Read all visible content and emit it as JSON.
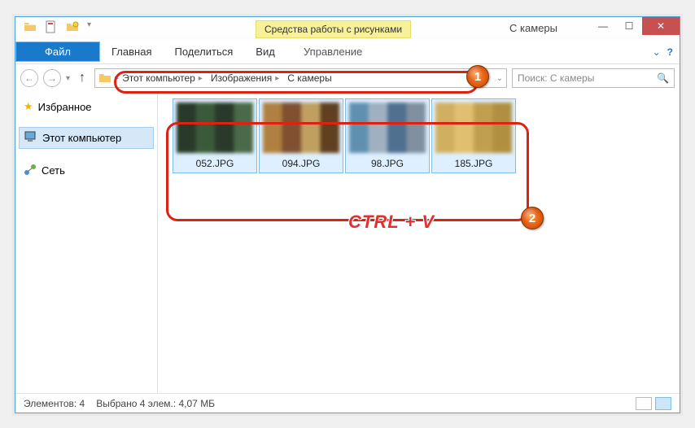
{
  "titlebar": {
    "tools_tab": "Средства работы с рисунками",
    "window_title": "С камеры"
  },
  "ribbon": {
    "file": "Файл",
    "home": "Главная",
    "share": "Поделиться",
    "view": "Вид",
    "manage": "Управление"
  },
  "breadcrumbs": {
    "items": [
      {
        "label": "Этот компьютер"
      },
      {
        "label": "Изображения"
      },
      {
        "label": "С камеры"
      }
    ]
  },
  "search": {
    "placeholder": "Поиск: С камеры"
  },
  "sidebar": {
    "favorites": "Избранное",
    "this_pc": "Этот компьютер",
    "network": "Сеть"
  },
  "files": [
    {
      "name": "052.JPG"
    },
    {
      "name": "094.JPG"
    },
    {
      "name": "98.JPG"
    },
    {
      "name": "185.JPG"
    }
  ],
  "statusbar": {
    "count": "Элементов: 4",
    "selection": "Выбрано 4 элем.: 4,07 МБ"
  },
  "annotations": {
    "m1": "1",
    "m2": "2",
    "keyboard_hint": "CTRL + V"
  }
}
